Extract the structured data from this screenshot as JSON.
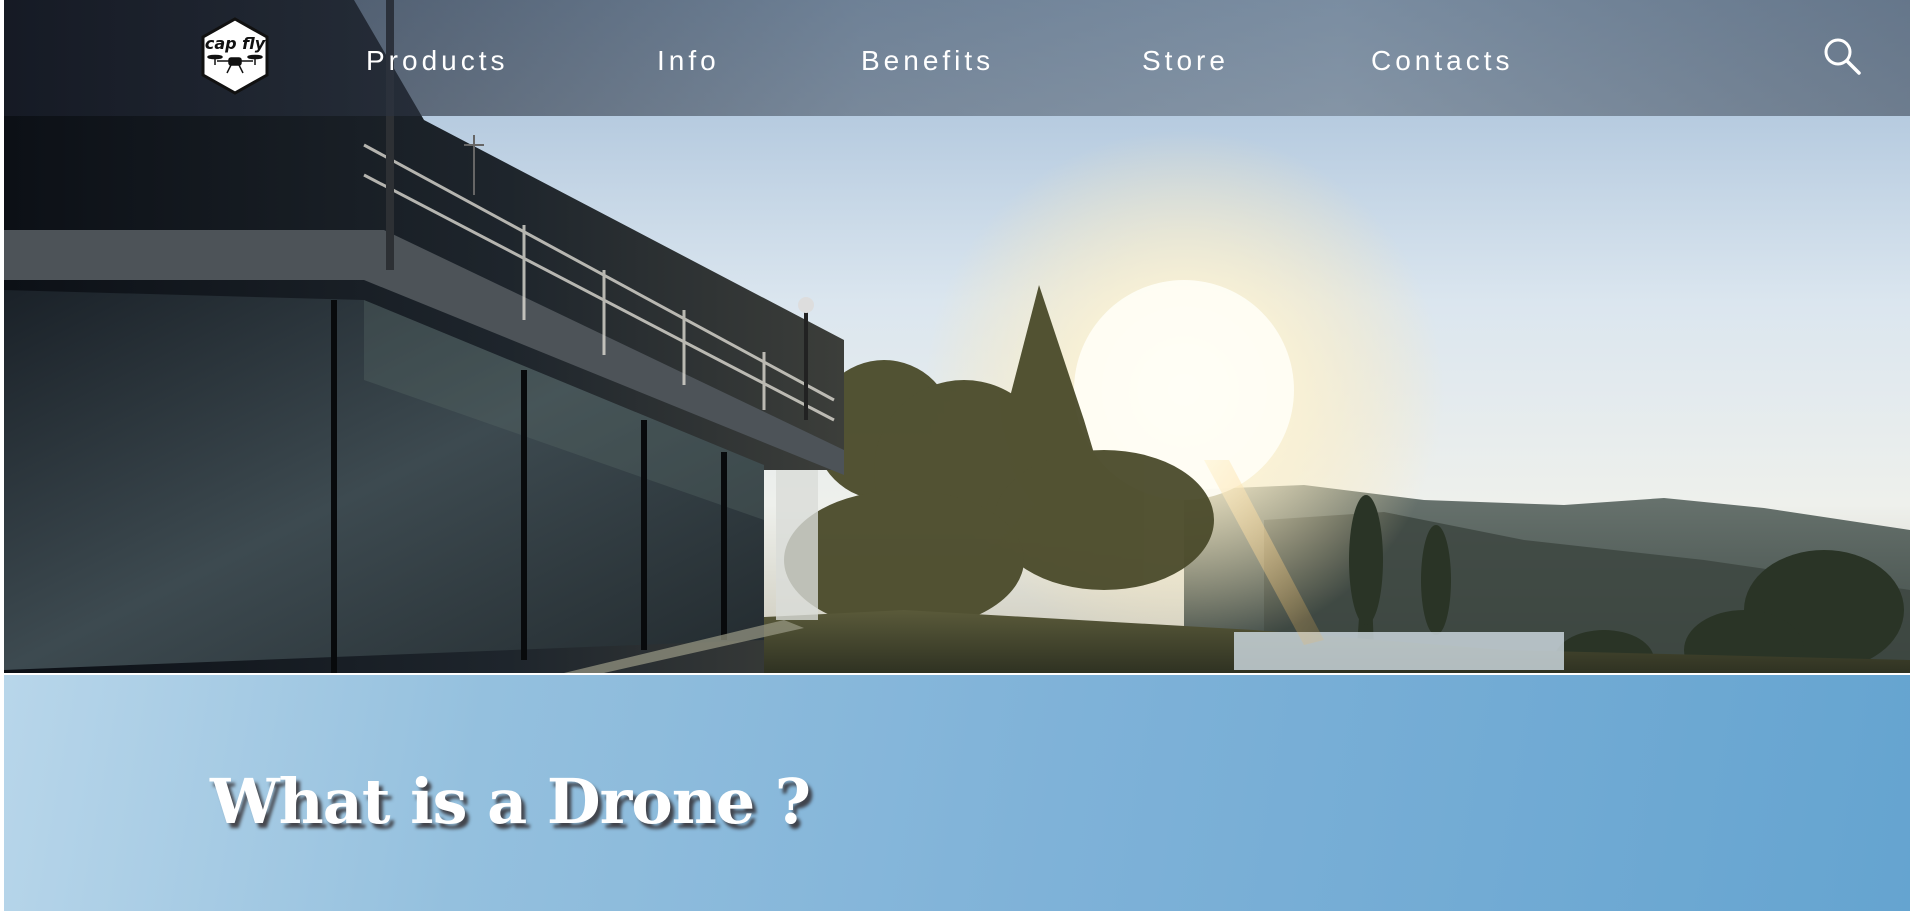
{
  "brand": {
    "logo_text": "cap fly",
    "logo_icon": "drone-hexagon-logo"
  },
  "nav": {
    "items": [
      {
        "label": "Products"
      },
      {
        "label": "Info"
      },
      {
        "label": "Benefits"
      },
      {
        "label": "Store"
      },
      {
        "label": "Contacts"
      }
    ],
    "search_icon": "search-icon"
  },
  "hero": {
    "scene": "hero-video-frame"
  },
  "intro": {
    "title": "What is a Drone ?"
  },
  "colors": {
    "nav_text": "#ffffff",
    "intro_bg_start": "#b8d6ea",
    "intro_bg_end": "#65a4d0",
    "title_text": "#ffffff"
  }
}
